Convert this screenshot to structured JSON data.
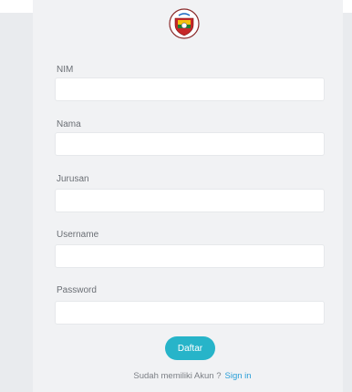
{
  "form": {
    "fields": [
      {
        "label": "NIM",
        "value": "",
        "placeholder": ""
      },
      {
        "label": "Nama",
        "value": "",
        "placeholder": ""
      },
      {
        "label": "Jurusan",
        "value": "",
        "placeholder": ""
      },
      {
        "label": "Username",
        "value": "",
        "placeholder": ""
      },
      {
        "label": "Password",
        "value": "",
        "placeholder": ""
      }
    ],
    "submit_label": "Daftar"
  },
  "footer": {
    "prompt": "Sudah memiliki Akun ?",
    "signin_label": "Sign in"
  },
  "logo": {
    "icon": "university-emblem-icon"
  },
  "colors": {
    "accent": "#27b4c9",
    "link": "#2a9fd8",
    "background": "#f1f2f4"
  }
}
